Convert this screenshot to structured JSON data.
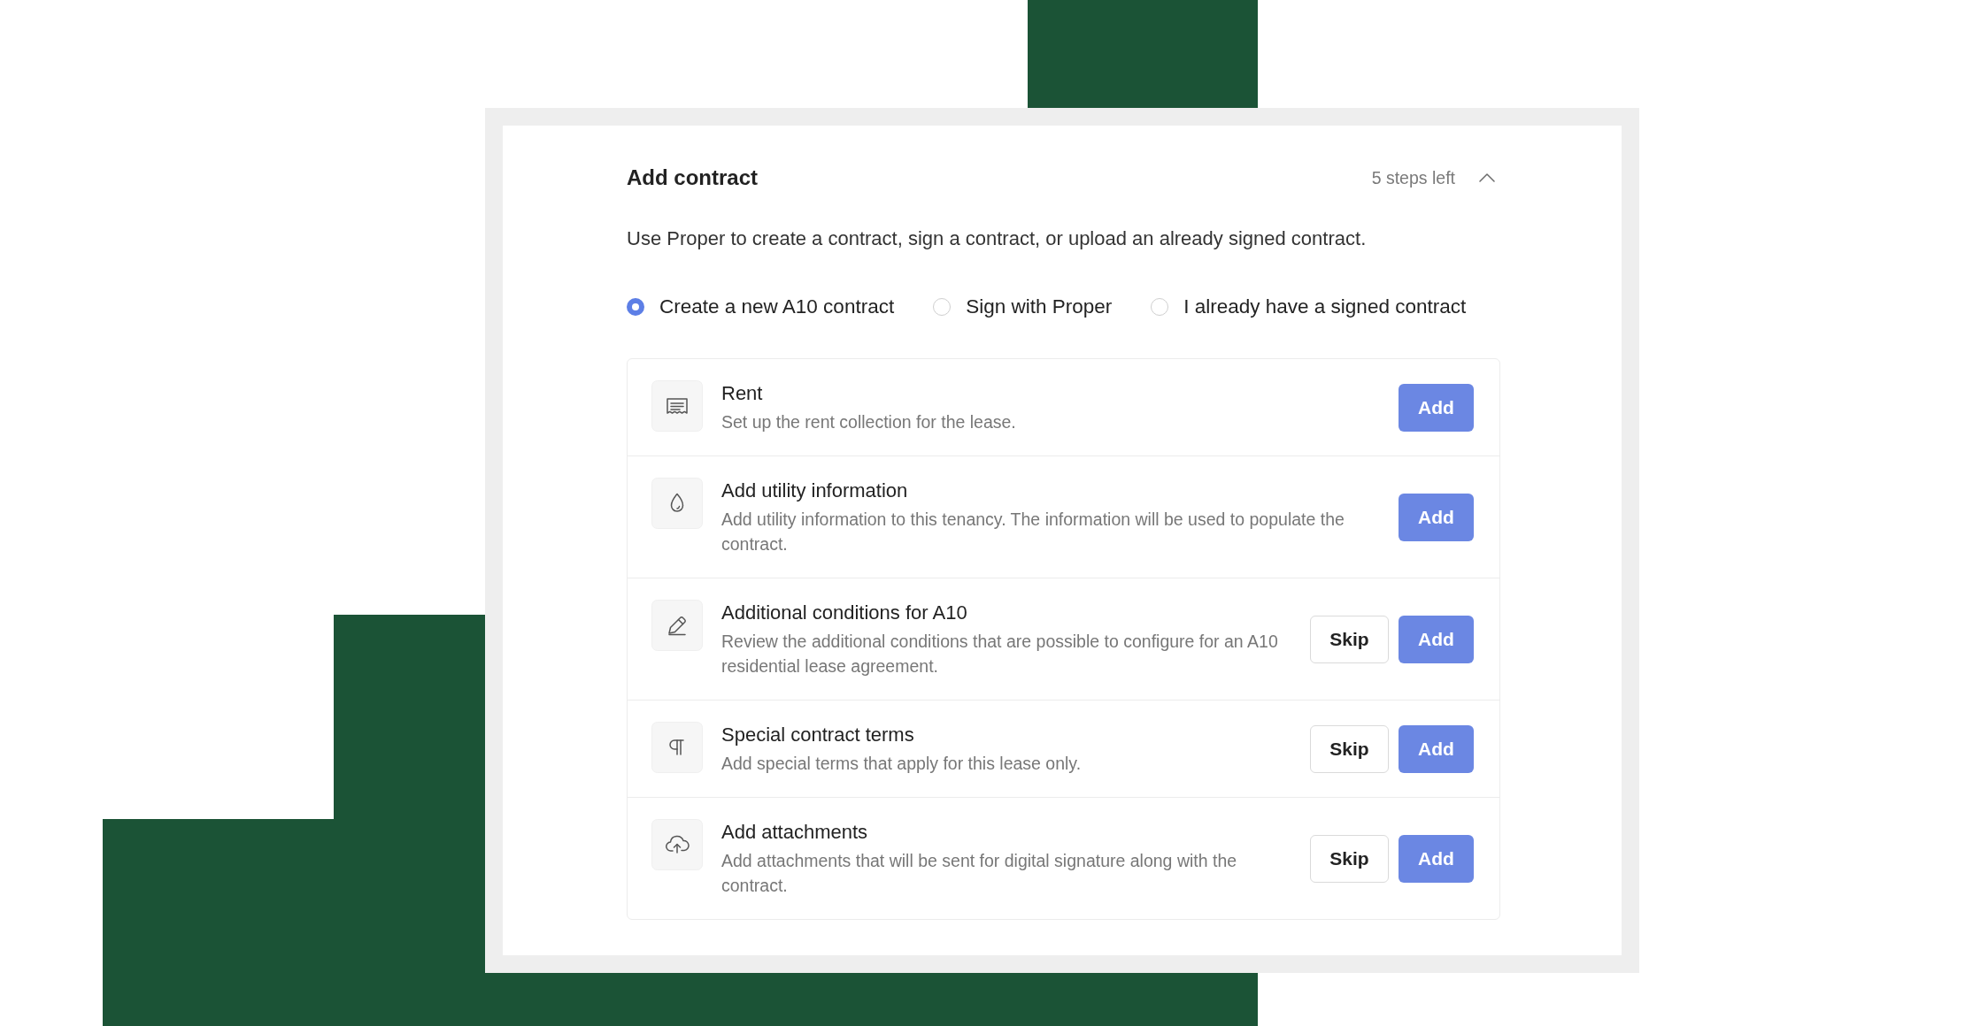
{
  "card": {
    "title": "Add contract",
    "steps_left": "5 steps left",
    "expanded": true,
    "description": "Use Proper to create a contract, sign a contract, or upload an already signed contract.",
    "contract_options": [
      {
        "label": "Create a new A10 contract",
        "selected": true
      },
      {
        "label": "Sign with Proper",
        "selected": false
      },
      {
        "label": "I already have a signed contract",
        "selected": false
      }
    ],
    "tasks": [
      {
        "title": "Rent",
        "description": "Set up the rent collection for the lease.",
        "buttons": [
          {
            "label": "Add",
            "kind": "primary"
          }
        ]
      },
      {
        "title": "Add utility information",
        "description": "Add utility information to this tenancy. The information will be used to populate the contract.",
        "buttons": [
          {
            "label": "Add",
            "kind": "primary"
          }
        ]
      },
      {
        "title": "Additional conditions for A10",
        "description": "Review the additional conditions that are possible to configure for an A10 residential lease agreement.",
        "buttons": [
          {
            "label": "Skip",
            "kind": "secondary"
          },
          {
            "label": "Add",
            "kind": "primary"
          }
        ]
      },
      {
        "title": "Special contract terms",
        "description": "Add special terms that apply for this lease only.",
        "buttons": [
          {
            "label": "Skip",
            "kind": "secondary"
          },
          {
            "label": "Add",
            "kind": "primary"
          }
        ]
      },
      {
        "title": "Add attachments",
        "description": "Add attachments that will be sent for digital signature along with the contract.",
        "buttons": [
          {
            "label": "Skip",
            "kind": "secondary"
          },
          {
            "label": "Add",
            "kind": "primary"
          }
        ]
      }
    ]
  }
}
